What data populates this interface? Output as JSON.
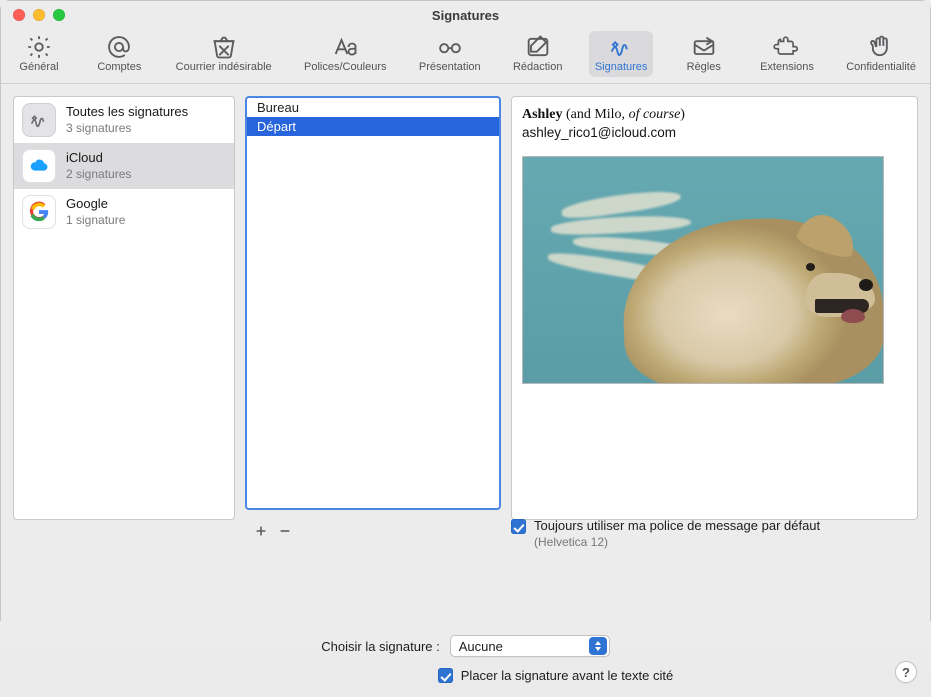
{
  "window": {
    "title": "Signatures"
  },
  "toolbar": {
    "items": [
      {
        "id": "general",
        "label": "Général"
      },
      {
        "id": "accounts",
        "label": "Comptes"
      },
      {
        "id": "junk",
        "label": "Courrier indésirable"
      },
      {
        "id": "fonts",
        "label": "Polices/Couleurs"
      },
      {
        "id": "viewing",
        "label": "Présentation"
      },
      {
        "id": "compose",
        "label": "Rédaction"
      },
      {
        "id": "signatures",
        "label": "Signatures",
        "selected": true
      },
      {
        "id": "rules",
        "label": "Règles"
      },
      {
        "id": "extensions",
        "label": "Extensions"
      },
      {
        "id": "privacy",
        "label": "Confidentialité"
      }
    ]
  },
  "accounts": [
    {
      "id": "all",
      "name": "Toutes les signatures",
      "subtitle": "3 signatures",
      "icon": "signature",
      "selected": false
    },
    {
      "id": "icloud",
      "name": "iCloud",
      "subtitle": "2 signatures",
      "icon": "cloud",
      "selected": true
    },
    {
      "id": "google",
      "name": "Google",
      "subtitle": "1 signature",
      "icon": "google",
      "selected": false
    }
  ],
  "signatureList": [
    {
      "name": "Bureau",
      "selected": false
    },
    {
      "name": "Départ",
      "selected": true
    }
  ],
  "preview": {
    "nameBold": "Ashley",
    "nameParenPrefix": " (and Milo, ",
    "nameItalic": "of course",
    "nameParenSuffix": ")",
    "email": "ashley_rico1@icloud.com",
    "imageAlt": "Photo of a long-haired dog with wind-blown fur"
  },
  "options": {
    "useDefaultFontLabel": "Toujours utiliser ma police de message par défaut",
    "useDefaultFontChecked": true,
    "defaultFontSubtitle": "(Helvetica 12)"
  },
  "chooseSignature": {
    "label": "Choisir la signature :",
    "value": "Aucune"
  },
  "placeBeforeQuoted": {
    "label": "Placer la signature avant le texte cité",
    "checked": true
  },
  "help": {
    "symbol": "?"
  }
}
